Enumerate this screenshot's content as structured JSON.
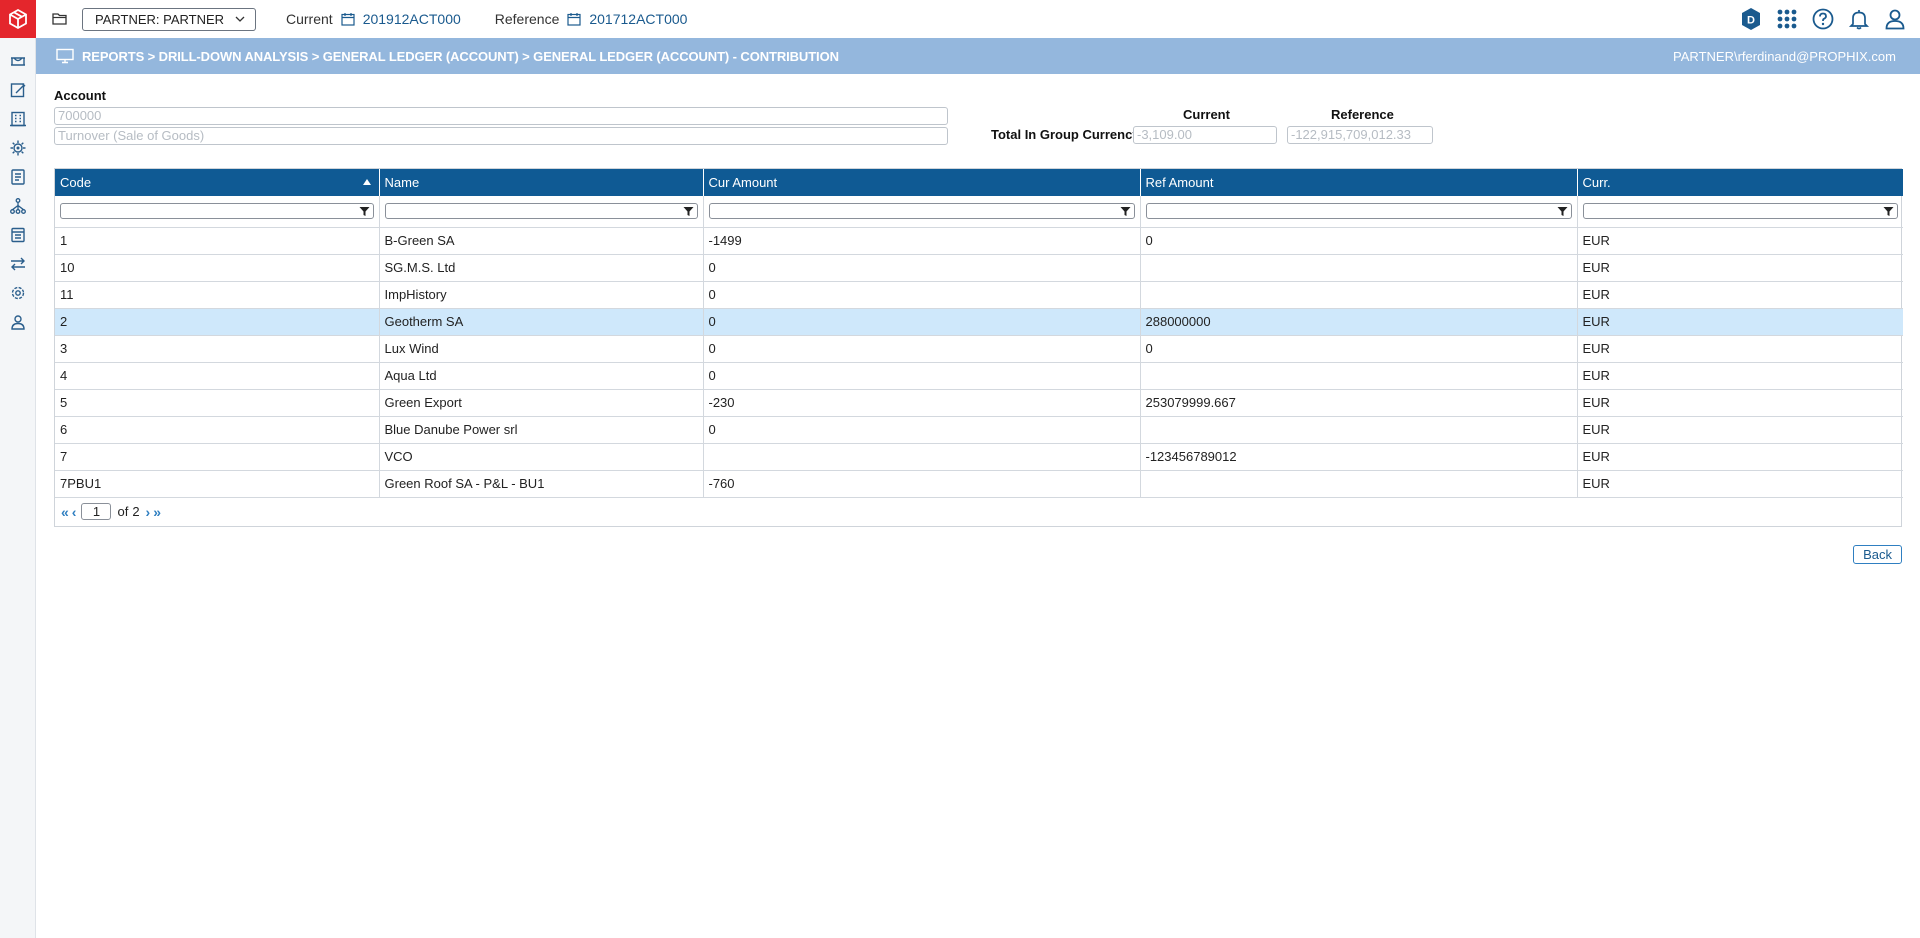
{
  "topbar": {
    "partner_select": "PARTNER: PARTNER",
    "current_label": "Current",
    "current_value": "201912ACT000",
    "reference_label": "Reference",
    "reference_value": "201712ACT000"
  },
  "breadcrumb": {
    "path": "REPORTS > DRILL-DOWN ANALYSIS > GENERAL LEDGER (ACCOUNT) > GENERAL LEDGER (ACCOUNT) - CONTRIBUTION",
    "user": "PARTNER\\rferdinand@PROPHIX.com"
  },
  "account": {
    "label": "Account",
    "code": "700000",
    "name": "Turnover (Sale of Goods)"
  },
  "totals": {
    "current_header": "Current",
    "reference_header": "Reference",
    "label": "Total In Group Currency",
    "current_value": "-3,109.00",
    "reference_value": "-122,915,709,012.33"
  },
  "grid": {
    "columns": [
      "Code",
      "Name",
      "Cur Amount",
      "Ref Amount",
      "Curr."
    ],
    "rows": [
      [
        "1",
        "B-Green SA",
        "-1499",
        "0",
        "EUR"
      ],
      [
        "10",
        "SG.M.S. Ltd",
        "0",
        "",
        "EUR"
      ],
      [
        "11",
        "ImpHistory",
        "0",
        "",
        "EUR"
      ],
      [
        "2",
        "Geotherm SA",
        "0",
        "288000000",
        "EUR"
      ],
      [
        "3",
        "Lux Wind",
        "0",
        "0",
        "EUR"
      ],
      [
        "4",
        "Aqua Ltd",
        "0",
        "",
        "EUR"
      ],
      [
        "5",
        "Green Export",
        "-230",
        "253079999.667",
        "EUR"
      ],
      [
        "6",
        "Blue Danube Power srl",
        "0",
        "",
        "EUR"
      ],
      [
        "7",
        "VCO",
        "",
        "-123456789012",
        "EUR"
      ],
      [
        "7PBU1",
        "Green Roof SA - P&L - BU1",
        "-760",
        "",
        "EUR"
      ]
    ],
    "selected_row": 3,
    "pager": {
      "page": "1",
      "of_label": "of",
      "total": "2"
    }
  },
  "back_label": "Back",
  "colors": {
    "brand_red": "#e4262c",
    "header_blue": "#0f5a94",
    "crumb_blue": "#94b7dd",
    "selected_row": "#cfe8fb",
    "link_blue": "#1a5a8e"
  },
  "icons": {
    "rail": [
      "cube-logo-icon",
      "bridge-icon",
      "edit-sheet-icon",
      "building-icon",
      "gear-network-icon",
      "document-list-icon",
      "hierarchy-icon",
      "database-icon",
      "transfer-icon",
      "settings-icon",
      "users-icon"
    ],
    "top": [
      "folder-icon",
      "calendar-icon",
      "d-badge-icon",
      "apps-grid-icon",
      "help-icon",
      "bell-icon",
      "user-icon"
    ]
  }
}
